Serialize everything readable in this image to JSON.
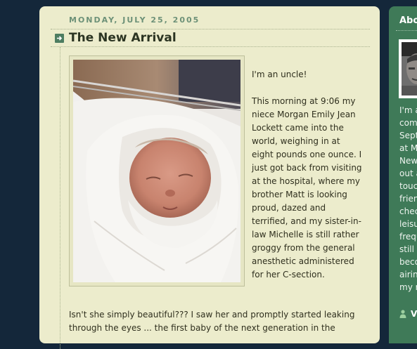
{
  "post": {
    "date": "MONDAY, JULY 25, 2005",
    "title": "The New Arrival",
    "paragraphs": [
      "I'm an uncle!",
      "This morning at 9:06 my niece Morgan Emily Jean Lockett came into the world, weighing in at eight pounds one ounce. I just got back from visiting at the hospital, where my brother Matt is looking proud, dazed and terrified, and my sister-in-law Michelle is still rather groggy from the general anesthetic administered for her C-section."
    ],
    "bottom_paragraph": "Isn't she simply beautiful??? I saw her and promptly started leaking through the eyes ... the first baby of the next generation in the"
  },
  "sidebar": {
    "title": "Abou",
    "text_lines": [
      "I'm a",
      "comp",
      "Sept",
      "at M",
      "New",
      "out a",
      "touc",
      "frien",
      "chec",
      "leisu",
      "frequ",
      "still",
      "beco",
      "airin",
      "my r"
    ],
    "profile_link": "Vi"
  },
  "colors": {
    "page_background": "#14273a",
    "card_background": "#ececcc",
    "date_color": "#6d9178",
    "sidebar_background": "#3f7a58"
  },
  "icons": {
    "title_bullet": "arrow-right-icon",
    "profile": "person-icon"
  }
}
